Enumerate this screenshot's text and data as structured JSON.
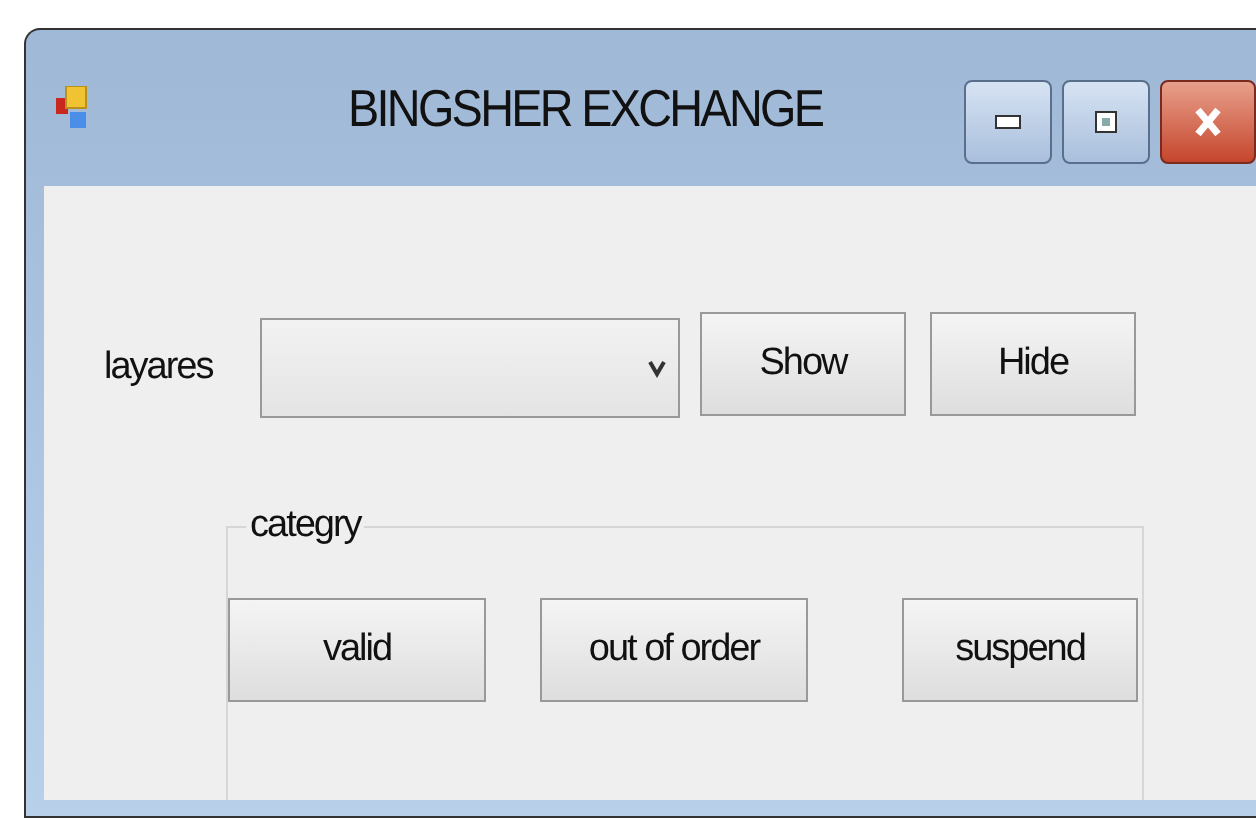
{
  "window": {
    "title": "BINGSHER EXCHANGE"
  },
  "layers": {
    "label": "layares",
    "buttons": [
      "Show",
      "Hide"
    ]
  },
  "category": {
    "title": "categry",
    "buttons": [
      "valid",
      "out of order",
      "suspend"
    ]
  }
}
